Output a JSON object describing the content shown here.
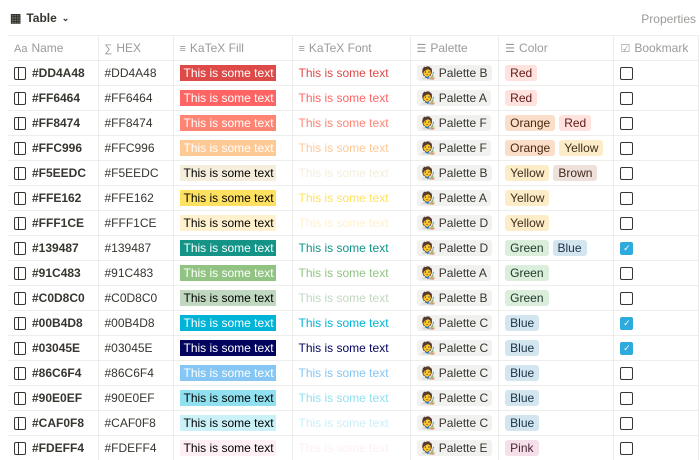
{
  "view": {
    "label": "Table",
    "properties": "Properties"
  },
  "columns": [
    "Name",
    "HEX",
    "KaTeX Fill",
    "KaTeX Font",
    "Palette",
    "Color",
    "Bookmark"
  ],
  "sample_text": "This is some text",
  "tag_colors": {
    "Red": [
      "#ffe2dd",
      "#5d1715"
    ],
    "Orange": [
      "#fadec9",
      "#49290e"
    ],
    "Yellow": [
      "#fdecc8",
      "#402c1b"
    ],
    "Brown": [
      "#eee0da",
      "#442a1e"
    ],
    "Green": [
      "#dbeddb",
      "#1c3829"
    ],
    "Blue": [
      "#d3e5ef",
      "#183347"
    ],
    "Pink": [
      "#f5e0e9",
      "#4c2337"
    ]
  },
  "rows": [
    {
      "name": "#DD4A48",
      "hex": "#DD4A48",
      "fill_text": "#ffffff",
      "palette": "Palette B",
      "colors": [
        "Red"
      ],
      "bookmark": false
    },
    {
      "name": "#FF6464",
      "hex": "#FF6464",
      "fill_text": "#ffffff",
      "palette": "Palette A",
      "colors": [
        "Red"
      ],
      "bookmark": false
    },
    {
      "name": "#FF8474",
      "hex": "#FF8474",
      "fill_text": "#ffffff",
      "palette": "Palette F",
      "colors": [
        "Orange",
        "Red"
      ],
      "bookmark": false
    },
    {
      "name": "#FFC996",
      "hex": "#FFC996",
      "fill_text": "#ffffff",
      "palette": "Palette F",
      "colors": [
        "Orange",
        "Yellow"
      ],
      "bookmark": false
    },
    {
      "name": "#F5EEDC",
      "hex": "#F5EEDC",
      "fill_text": "#000000",
      "palette": "Palette B",
      "colors": [
        "Yellow",
        "Brown"
      ],
      "bookmark": false
    },
    {
      "name": "#FFE162",
      "hex": "#FFE162",
      "fill_text": "#000000",
      "palette": "Palette A",
      "colors": [
        "Yellow"
      ],
      "bookmark": false
    },
    {
      "name": "#FFF1CE",
      "hex": "#FFF1CE",
      "fill_text": "#000000",
      "palette": "Palette D",
      "colors": [
        "Yellow"
      ],
      "bookmark": false
    },
    {
      "name": "#139487",
      "hex": "#139487",
      "fill_text": "#ffffff",
      "palette": "Palette D",
      "colors": [
        "Green",
        "Blue"
      ],
      "bookmark": true
    },
    {
      "name": "#91C483",
      "hex": "#91C483",
      "fill_text": "#ffffff",
      "palette": "Palette A",
      "colors": [
        "Green"
      ],
      "bookmark": false
    },
    {
      "name": "#C0D8C0",
      "hex": "#C0D8C0",
      "fill_text": "#000000",
      "palette": "Palette B",
      "colors": [
        "Green"
      ],
      "bookmark": false
    },
    {
      "name": "#00B4D8",
      "hex": "#00B4D8",
      "fill_text": "#ffffff",
      "palette": "Palette C",
      "colors": [
        "Blue"
      ],
      "bookmark": true
    },
    {
      "name": "#03045E",
      "hex": "#03045E",
      "fill_text": "#ffffff",
      "palette": "Palette C",
      "colors": [
        "Blue"
      ],
      "bookmark": true
    },
    {
      "name": "#86C6F4",
      "hex": "#86C6F4",
      "fill_text": "#ffffff",
      "palette": "Palette C",
      "colors": [
        "Blue"
      ],
      "bookmark": false
    },
    {
      "name": "#90E0EF",
      "hex": "#90E0EF",
      "fill_text": "#000000",
      "palette": "Palette C",
      "colors": [
        "Blue"
      ],
      "bookmark": false
    },
    {
      "name": "#CAF0F8",
      "hex": "#CAF0F8",
      "fill_text": "#000000",
      "palette": "Palette C",
      "colors": [
        "Blue"
      ],
      "bookmark": false
    },
    {
      "name": "#FDEFF4",
      "hex": "#FDEFF4",
      "fill_text": "#000000",
      "palette": "Palette E",
      "colors": [
        "Pink"
      ],
      "bookmark": false
    }
  ]
}
